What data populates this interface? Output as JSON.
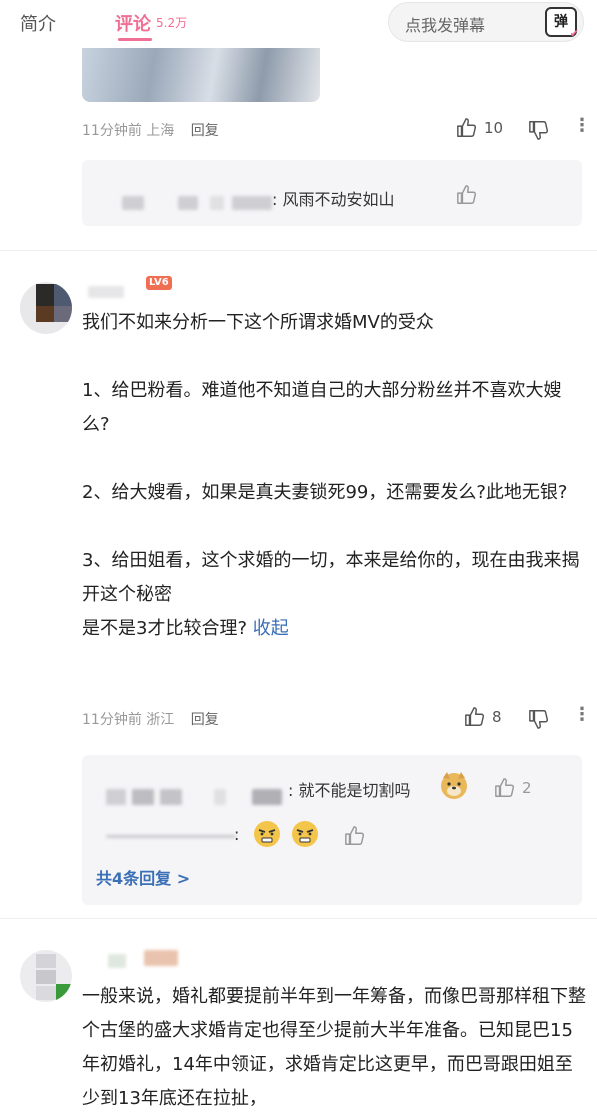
{
  "tabs": {
    "intro": "简介",
    "comments": "评论",
    "comments_count": "5.2万"
  },
  "danmaku": {
    "placeholder": "点我发弹幕",
    "button": "弹"
  },
  "comments": [
    {
      "time": "11分钟前",
      "location": "上海",
      "reply": "回复",
      "likes": "10",
      "sub_replies": [
        {
          "text": ": 风雨不动安如山"
        }
      ]
    },
    {
      "level": "LV6",
      "paragraphs": [
        "我们不如来分析一下这个所谓求婚MV的受众",
        "1、给巴粉看。难道他不知道自己的大部分粉丝并不喜欢大嫂么?",
        "2、给大嫂看，如果是真夫妻锁死99，还需要发么?此地无银?",
        "3、给田姐看，这个求婚的一切，本来是给你的，现在由我来揭开这个秘密",
        "是不是3才比较合理?"
      ],
      "collapse": "收起",
      "time": "11分钟前",
      "location": "浙江",
      "reply": "回复",
      "likes": "8",
      "sub_replies": [
        {
          "text": ": 就不能是切割吗",
          "likes": "2"
        },
        {
          "text": ":"
        }
      ],
      "more_replies": "共4条回复 >"
    },
    {
      "text": "一般来说，婚礼都要提前半年到一年筹备，而像巴哥那样租下整个古堡的盛大求婚肯定也得至少提前大半年准备。已知昆巴15年初婚礼，14年中领证，求婚肯定比这更早，而巴哥跟田姐至少到13年底还在拉扯，"
    }
  ]
}
